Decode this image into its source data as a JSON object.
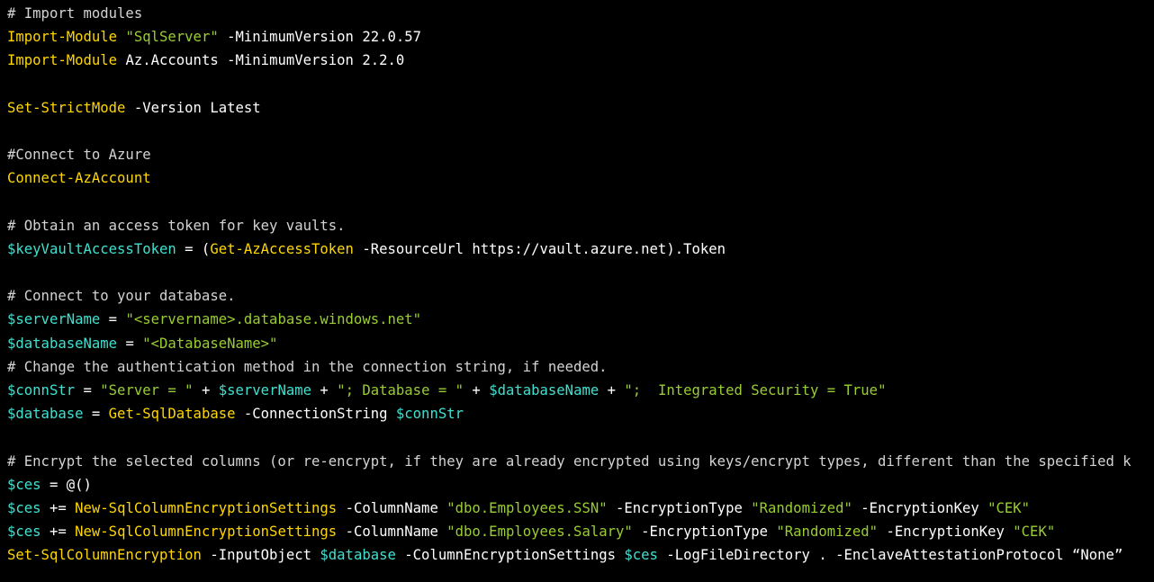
{
  "colors": {
    "background": "#000000",
    "default": "#ffffff",
    "comment": "#d3d3d3",
    "cmdlet": "#ffd700",
    "variable": "#40e0d0",
    "string": "#9acd32",
    "parameter": "#ffffff"
  },
  "code": {
    "language": "PowerShell",
    "lines": [
      [
        {
          "t": "comment",
          "v": "# Import modules"
        }
      ],
      [
        {
          "t": "cmdlet",
          "v": "Import-Module"
        },
        {
          "t": "text",
          "v": " "
        },
        {
          "t": "string",
          "v": "\"SqlServer\""
        },
        {
          "t": "text",
          "v": " "
        },
        {
          "t": "param",
          "v": "-MinimumVersion"
        },
        {
          "t": "text",
          "v": " 22.0.57"
        }
      ],
      [
        {
          "t": "cmdlet",
          "v": "Import-Module"
        },
        {
          "t": "text",
          "v": " Az.Accounts "
        },
        {
          "t": "param",
          "v": "-MinimumVersion"
        },
        {
          "t": "text",
          "v": " 2.2.0"
        }
      ],
      [],
      [
        {
          "t": "cmdlet",
          "v": "Set-StrictMode"
        },
        {
          "t": "text",
          "v": " "
        },
        {
          "t": "param",
          "v": "-Version"
        },
        {
          "t": "text",
          "v": " Latest"
        }
      ],
      [],
      [
        {
          "t": "comment",
          "v": "#Connect to Azure"
        }
      ],
      [
        {
          "t": "cmdlet",
          "v": "Connect-AzAccount"
        }
      ],
      [],
      [
        {
          "t": "comment",
          "v": "# Obtain an access token for key vaults."
        }
      ],
      [
        {
          "t": "variable",
          "v": "$keyVaultAccessToken"
        },
        {
          "t": "operator",
          "v": " = ("
        },
        {
          "t": "cmdlet",
          "v": "Get-AzAccessToken"
        },
        {
          "t": "text",
          "v": " "
        },
        {
          "t": "param",
          "v": "-ResourceUrl"
        },
        {
          "t": "text",
          "v": " https://vault.azure.net).Token"
        }
      ],
      [],
      [
        {
          "t": "comment",
          "v": "# Connect to your database."
        }
      ],
      [
        {
          "t": "variable",
          "v": "$serverName"
        },
        {
          "t": "operator",
          "v": " = "
        },
        {
          "t": "string",
          "v": "\"<servername>.database.windows.net\""
        }
      ],
      [
        {
          "t": "variable",
          "v": "$databaseName"
        },
        {
          "t": "operator",
          "v": " = "
        },
        {
          "t": "string",
          "v": "\"<DatabaseName>\""
        }
      ],
      [
        {
          "t": "comment",
          "v": "# Change the authentication method in the connection string, if needed."
        }
      ],
      [
        {
          "t": "variable",
          "v": "$connStr"
        },
        {
          "t": "operator",
          "v": " = "
        },
        {
          "t": "string",
          "v": "\"Server = \""
        },
        {
          "t": "operator",
          "v": " + "
        },
        {
          "t": "variable",
          "v": "$serverName"
        },
        {
          "t": "operator",
          "v": " + "
        },
        {
          "t": "string",
          "v": "\"; Database = \""
        },
        {
          "t": "operator",
          "v": " + "
        },
        {
          "t": "variable",
          "v": "$databaseName"
        },
        {
          "t": "operator",
          "v": " + "
        },
        {
          "t": "string",
          "v": "\";  Integrated Security = True\""
        }
      ],
      [
        {
          "t": "variable",
          "v": "$database"
        },
        {
          "t": "operator",
          "v": " = "
        },
        {
          "t": "cmdlet",
          "v": "Get-SqlDatabase"
        },
        {
          "t": "text",
          "v": " "
        },
        {
          "t": "param",
          "v": "-ConnectionString"
        },
        {
          "t": "text",
          "v": " "
        },
        {
          "t": "variable",
          "v": "$connStr"
        }
      ],
      [],
      [
        {
          "t": "comment",
          "v": "# Encrypt the selected columns (or re-encrypt, if they are already encrypted using keys/encrypt types, different than the specified k"
        }
      ],
      [
        {
          "t": "variable",
          "v": "$ces"
        },
        {
          "t": "operator",
          "v": " = @()"
        }
      ],
      [
        {
          "t": "variable",
          "v": "$ces"
        },
        {
          "t": "operator",
          "v": " += "
        },
        {
          "t": "cmdlet",
          "v": "New-SqlColumnEncryptionSettings"
        },
        {
          "t": "text",
          "v": " "
        },
        {
          "t": "param",
          "v": "-ColumnName"
        },
        {
          "t": "text",
          "v": " "
        },
        {
          "t": "string",
          "v": "\"dbo.Employees.SSN\""
        },
        {
          "t": "text",
          "v": " "
        },
        {
          "t": "param",
          "v": "-EncryptionType"
        },
        {
          "t": "text",
          "v": " "
        },
        {
          "t": "string",
          "v": "\"Randomized\""
        },
        {
          "t": "text",
          "v": " "
        },
        {
          "t": "param",
          "v": "-EncryptionKey"
        },
        {
          "t": "text",
          "v": " "
        },
        {
          "t": "string",
          "v": "\"CEK\""
        }
      ],
      [
        {
          "t": "variable",
          "v": "$ces"
        },
        {
          "t": "operator",
          "v": " += "
        },
        {
          "t": "cmdlet",
          "v": "New-SqlColumnEncryptionSettings"
        },
        {
          "t": "text",
          "v": " "
        },
        {
          "t": "param",
          "v": "-ColumnName"
        },
        {
          "t": "text",
          "v": " "
        },
        {
          "t": "string",
          "v": "\"dbo.Employees.Salary\""
        },
        {
          "t": "text",
          "v": " "
        },
        {
          "t": "param",
          "v": "-EncryptionType"
        },
        {
          "t": "text",
          "v": " "
        },
        {
          "t": "string",
          "v": "\"Randomized\""
        },
        {
          "t": "text",
          "v": " "
        },
        {
          "t": "param",
          "v": "-EncryptionKey"
        },
        {
          "t": "text",
          "v": " "
        },
        {
          "t": "string",
          "v": "\"CEK\""
        }
      ],
      [
        {
          "t": "cmdlet",
          "v": "Set-SqlColumnEncryption"
        },
        {
          "t": "text",
          "v": " "
        },
        {
          "t": "param",
          "v": "-InputObject"
        },
        {
          "t": "text",
          "v": " "
        },
        {
          "t": "variable",
          "v": "$database"
        },
        {
          "t": "text",
          "v": " "
        },
        {
          "t": "param",
          "v": "-ColumnEncryptionSettings"
        },
        {
          "t": "text",
          "v": " "
        },
        {
          "t": "variable",
          "v": "$ces"
        },
        {
          "t": "text",
          "v": " "
        },
        {
          "t": "param",
          "v": "-LogFileDirectory"
        },
        {
          "t": "text",
          "v": " . "
        },
        {
          "t": "param",
          "v": "-EnclaveAttestationProtocol"
        },
        {
          "t": "text",
          "v": " “None”"
        }
      ]
    ]
  }
}
